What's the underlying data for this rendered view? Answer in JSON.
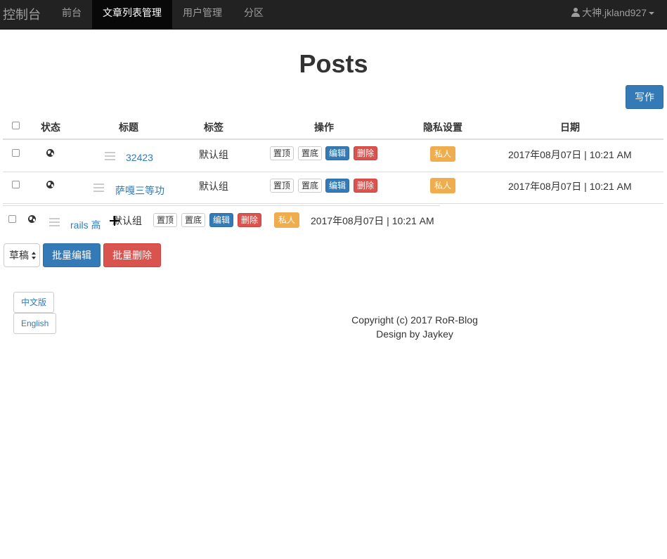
{
  "navbar": {
    "brand": "控制台",
    "items": [
      {
        "label": "前台",
        "active": false
      },
      {
        "label": "文章列表管理",
        "active": true
      },
      {
        "label": "用户管理",
        "active": false
      },
      {
        "label": "分区",
        "active": false
      }
    ],
    "user": "大神.jkland927"
  },
  "page_title": "Posts",
  "write_button": "写作",
  "table": {
    "headers": [
      "状态",
      "标题",
      "标签",
      "操作",
      "隐私设置",
      "日期"
    ],
    "rows": [
      {
        "title": "32423",
        "tag": "默认组",
        "actions": [
          "置顶",
          "置底",
          "编辑",
          "删除"
        ],
        "privacy": "私人",
        "date": "2017年08月07日 | 10:21 AM"
      },
      {
        "title": "萨嘎三等功",
        "tag": "默认组",
        "actions": [
          "置顶",
          "置底",
          "编辑",
          "删除"
        ],
        "privacy": "私人",
        "date": "2017年08月07日 | 10:21 AM"
      },
      {
        "title": "rails 高",
        "tag": "默认组",
        "actions": [
          "置顶",
          "置底",
          "编辑",
          "删除"
        ],
        "privacy": "私人",
        "date": "2017年08月07日 | 10:21 AM"
      }
    ]
  },
  "bulk": {
    "select_value": "草稿",
    "edit_label": "批量编辑",
    "delete_label": "批量删除"
  },
  "language": {
    "chinese": "中文版",
    "english": "English"
  },
  "footer": {
    "copyright": "Copyright (c) 2017 RoR-Blog",
    "design": "Design by Jaykey"
  },
  "colors": {
    "primary": "#337ab7",
    "danger": "#d9534f",
    "warning": "#f0ad4e",
    "navbar": "#222222"
  }
}
